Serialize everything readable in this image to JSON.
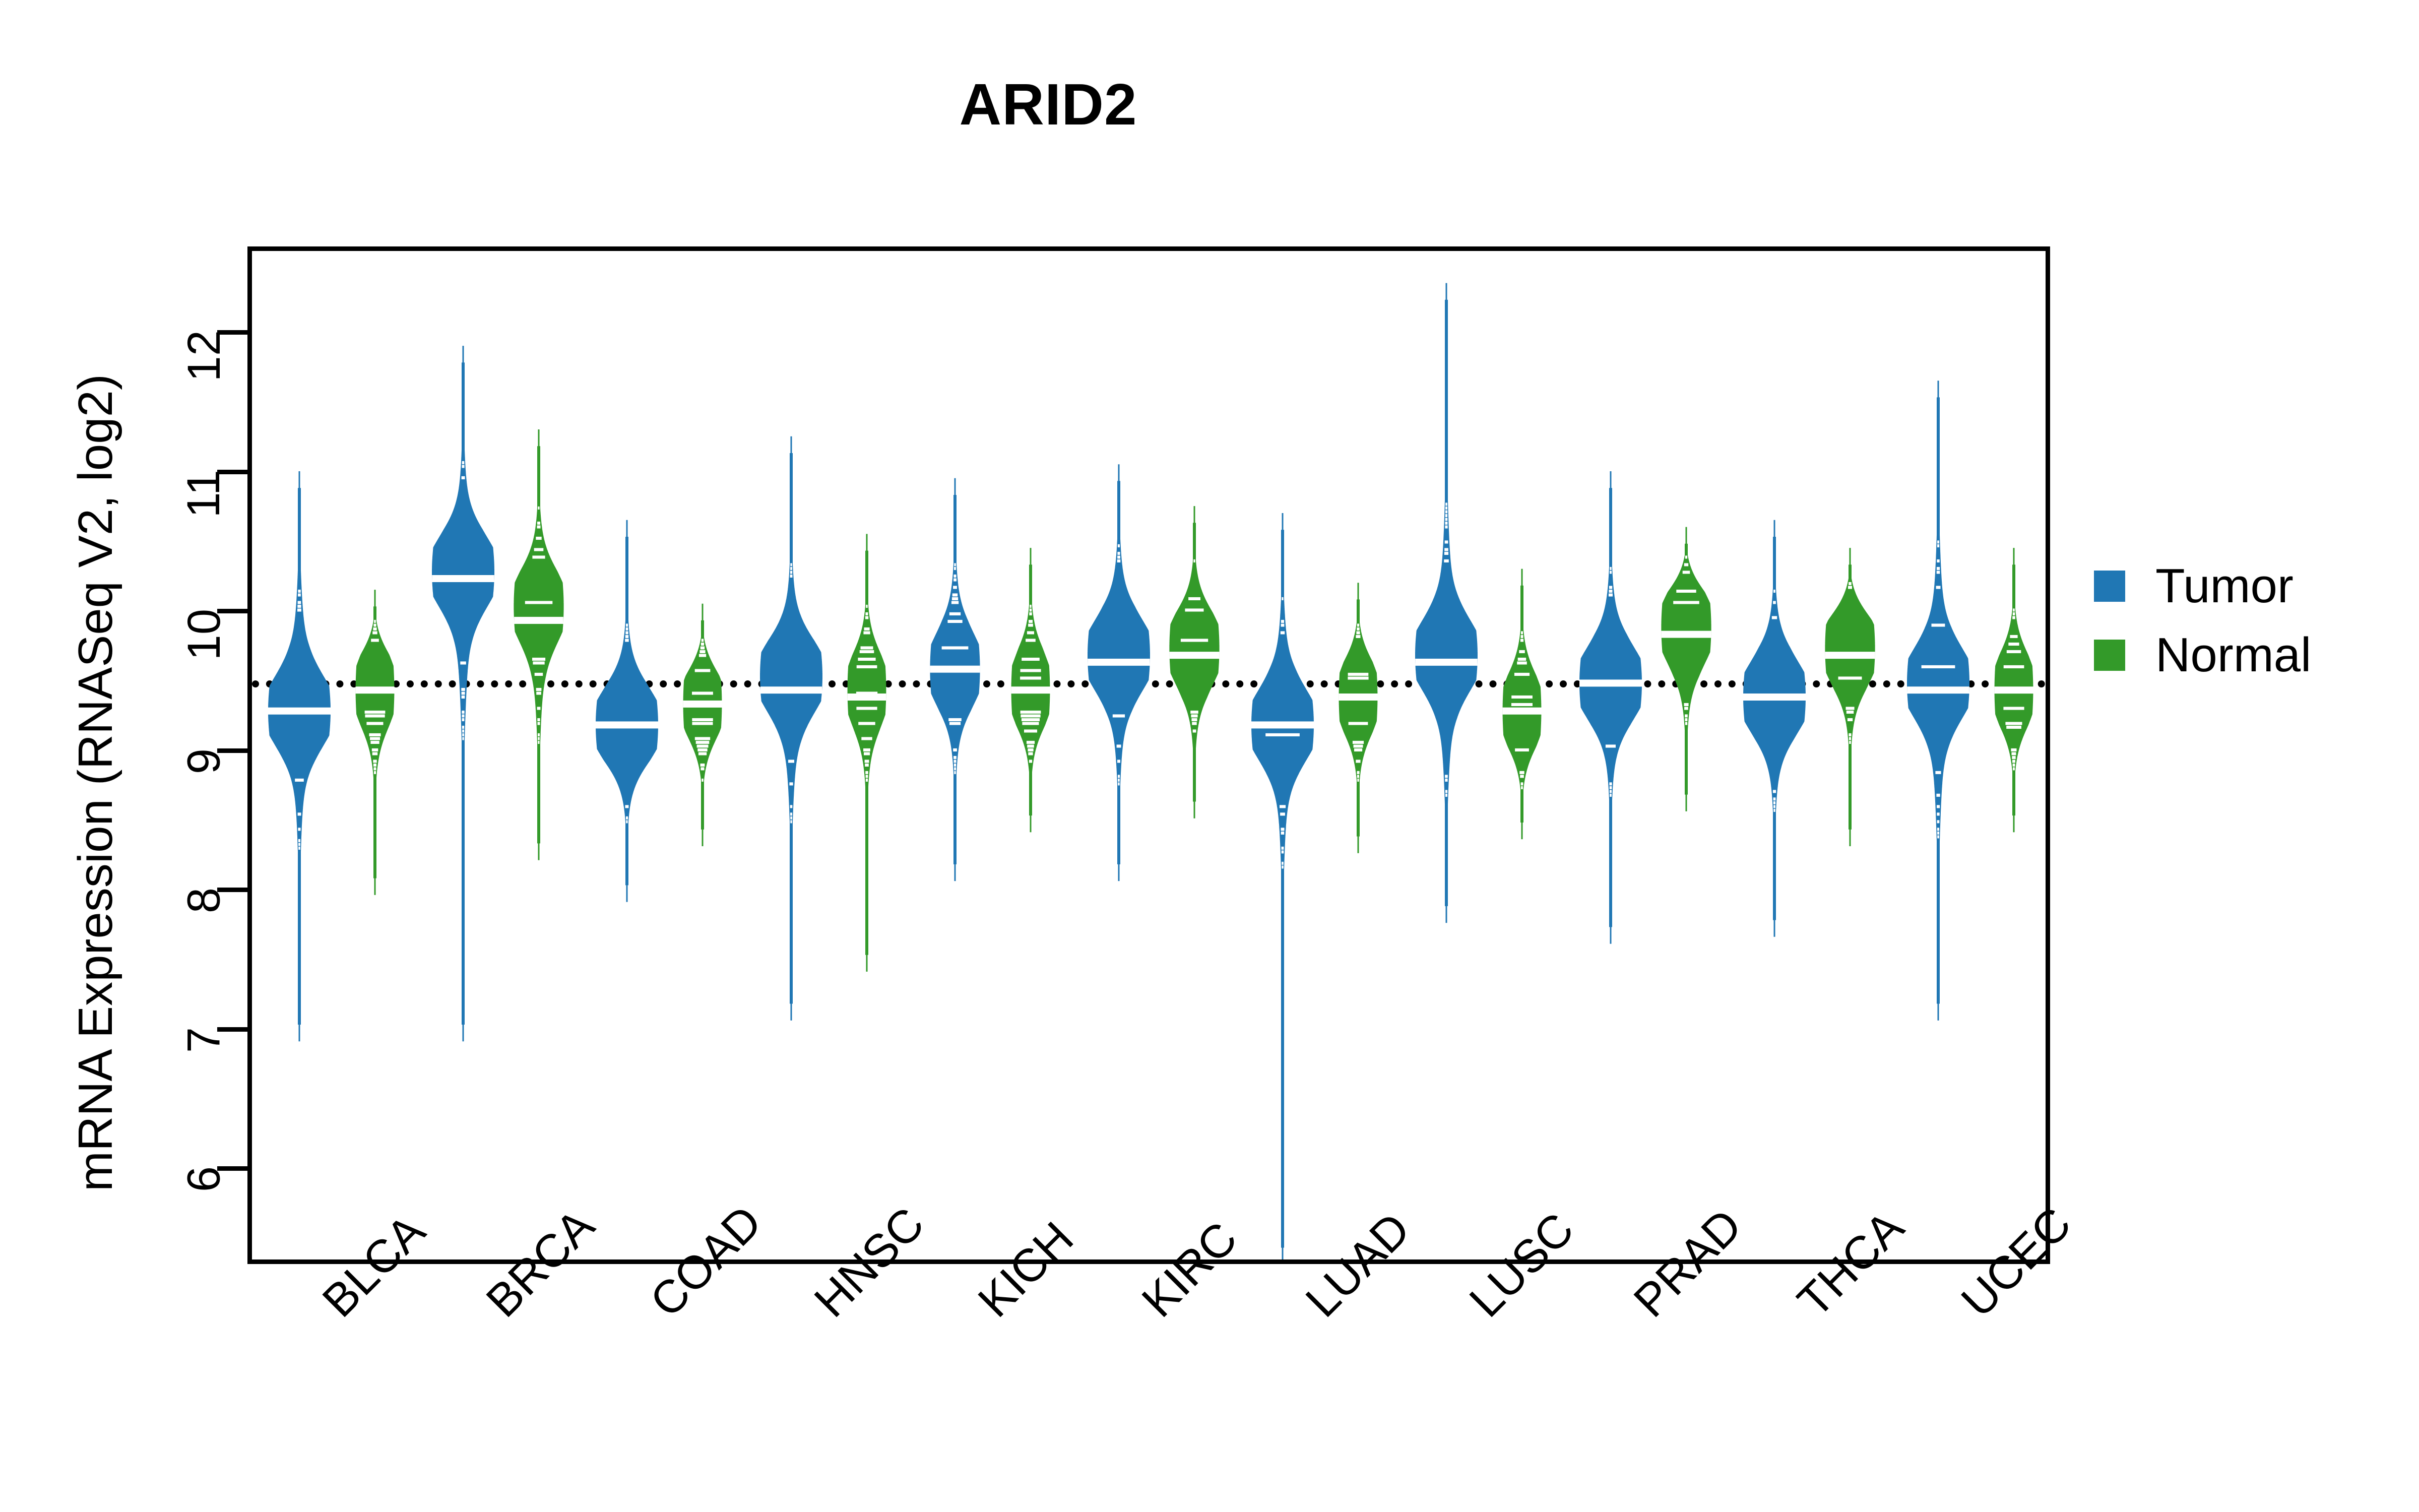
{
  "chart_data": {
    "type": "beanplot",
    "title": "ARID2",
    "xlabel": "",
    "ylabel": "mRNA Expression (RNASeq V2, log2)",
    "ylim": [
      5.3,
      12.6
    ],
    "yticks": [
      6,
      7,
      8,
      9,
      10,
      11,
      12
    ],
    "ytick_labels": [
      "6",
      "7",
      "8",
      "9",
      "10",
      "11",
      "12"
    ],
    "grid": false,
    "reference_line": {
      "value": 9.52,
      "style": "dotted",
      "color": "#000000"
    },
    "legend": {
      "position": "right",
      "entries": [
        {
          "label": "Tumor",
          "color": "#2077B4"
        },
        {
          "label": "Normal",
          "color": "#339A29"
        }
      ]
    },
    "categories": [
      "BLCA",
      "BRCA",
      "COAD",
      "HNSC",
      "KICH",
      "KIRC",
      "LUAD",
      "LUSC",
      "PRAD",
      "THCA",
      "UCEC"
    ],
    "series": [
      {
        "name": "Tumor",
        "color": "#2077B4",
        "groups": [
          {
            "category": "BLCA",
            "median": 9.3,
            "q1": 8.95,
            "q3": 9.75,
            "min": 7.05,
            "max": 10.9,
            "density_peak": 9.3,
            "n_band": "wide"
          },
          {
            "category": "BRCA",
            "median": 10.25,
            "q1": 9.8,
            "q3": 10.6,
            "min": 7.05,
            "max": 11.8,
            "density_peak": 10.3,
            "n_band": "wide"
          },
          {
            "category": "COAD",
            "median": 9.2,
            "q1": 8.95,
            "q3": 9.5,
            "min": 8.05,
            "max": 10.55,
            "density_peak": 9.2,
            "n_band": "wide"
          },
          {
            "category": "HNSC",
            "median": 9.45,
            "q1": 9.1,
            "q3": 9.8,
            "min": 7.2,
            "max": 11.15,
            "density_peak": 9.55,
            "n_band": "wide"
          },
          {
            "category": "KICH",
            "median": 9.6,
            "q1": 9.3,
            "q3": 9.95,
            "min": 8.2,
            "max": 10.85,
            "density_peak": 9.6,
            "n_band": "medium"
          },
          {
            "category": "KIRC",
            "median": 9.65,
            "q1": 9.3,
            "q3": 10.05,
            "min": 8.2,
            "max": 10.95,
            "density_peak": 9.7,
            "n_band": "wide"
          },
          {
            "category": "LUAD",
            "median": 9.2,
            "q1": 8.85,
            "q3": 9.6,
            "min": 5.45,
            "max": 10.6,
            "density_peak": 9.2,
            "n_band": "wide"
          },
          {
            "category": "LUSC",
            "median": 9.65,
            "q1": 9.25,
            "q3": 10.1,
            "min": 7.9,
            "max": 12.25,
            "density_peak": 9.7,
            "n_band": "wide"
          },
          {
            "category": "PRAD",
            "median": 9.5,
            "q1": 9.2,
            "q3": 9.85,
            "min": 7.75,
            "max": 10.9,
            "density_peak": 9.5,
            "n_band": "wide"
          },
          {
            "category": "THCA",
            "median": 9.4,
            "q1": 9.1,
            "q3": 9.75,
            "min": 7.8,
            "max": 10.55,
            "density_peak": 9.4,
            "n_band": "wide"
          },
          {
            "category": "UCEC",
            "median": 9.45,
            "q1": 9.05,
            "q3": 9.9,
            "min": 7.2,
            "max": 11.55,
            "density_peak": 9.5,
            "n_band": "wide"
          }
        ]
      },
      {
        "name": "Normal",
        "color": "#339A29",
        "groups": [
          {
            "category": "BLCA",
            "median": 9.45,
            "q1": 9.2,
            "q3": 9.7,
            "min": 8.1,
            "max": 10.05,
            "density_peak": 9.45,
            "n_band": "narrow"
          },
          {
            "category": "BRCA",
            "median": 9.95,
            "q1": 9.55,
            "q3": 10.3,
            "min": 8.35,
            "max": 11.2,
            "density_peak": 10.05,
            "n_band": "medium"
          },
          {
            "category": "COAD",
            "median": 9.35,
            "q1": 9.15,
            "q3": 9.55,
            "min": 8.45,
            "max": 9.95,
            "density_peak": 9.35,
            "n_band": "narrow"
          },
          {
            "category": "HNSC",
            "median": 9.4,
            "q1": 9.15,
            "q3": 9.7,
            "min": 7.55,
            "max": 10.45,
            "density_peak": 9.45,
            "n_band": "narrow"
          },
          {
            "category": "KICH",
            "median": 9.45,
            "q1": 9.2,
            "q3": 9.75,
            "min": 8.55,
            "max": 10.35,
            "density_peak": 9.45,
            "n_band": "narrow"
          },
          {
            "category": "KIRC",
            "median": 9.7,
            "q1": 9.4,
            "q3": 10.0,
            "min": 8.65,
            "max": 10.65,
            "density_peak": 9.75,
            "n_band": "medium"
          },
          {
            "category": "LUAD",
            "median": 9.4,
            "q1": 9.15,
            "q3": 9.65,
            "min": 8.4,
            "max": 10.1,
            "density_peak": 9.4,
            "n_band": "narrow"
          },
          {
            "category": "LUSC",
            "median": 9.3,
            "q1": 9.05,
            "q3": 9.55,
            "min": 8.5,
            "max": 10.2,
            "density_peak": 9.3,
            "n_band": "narrow"
          },
          {
            "category": "PRAD",
            "median": 9.85,
            "q1": 9.55,
            "q3": 10.15,
            "min": 8.7,
            "max": 10.5,
            "density_peak": 9.9,
            "n_band": "medium"
          },
          {
            "category": "THCA",
            "median": 9.7,
            "q1": 9.45,
            "q3": 9.95,
            "min": 8.45,
            "max": 10.35,
            "density_peak": 9.75,
            "n_band": "medium"
          },
          {
            "category": "UCEC",
            "median": 9.45,
            "q1": 9.2,
            "q3": 9.7,
            "min": 8.55,
            "max": 10.35,
            "density_peak": 9.45,
            "n_band": "narrow"
          }
        ]
      }
    ]
  },
  "title": {
    "text": "ARID2"
  },
  "axes": {
    "y_label": "mRNA Expression (RNASeq V2, log2)",
    "y_ticks": [
      "6",
      "7",
      "8",
      "9",
      "10",
      "11",
      "12"
    ],
    "x_ticks": [
      "BLCA",
      "BRCA",
      "COAD",
      "HNSC",
      "KICH",
      "KIRC",
      "LUAD",
      "LUSC",
      "PRAD",
      "THCA",
      "UCEC"
    ]
  },
  "legend": {
    "tumor_label": "Tumor",
    "normal_label": "Normal",
    "tumor_color": "#2077B4",
    "normal_color": "#339A29"
  }
}
